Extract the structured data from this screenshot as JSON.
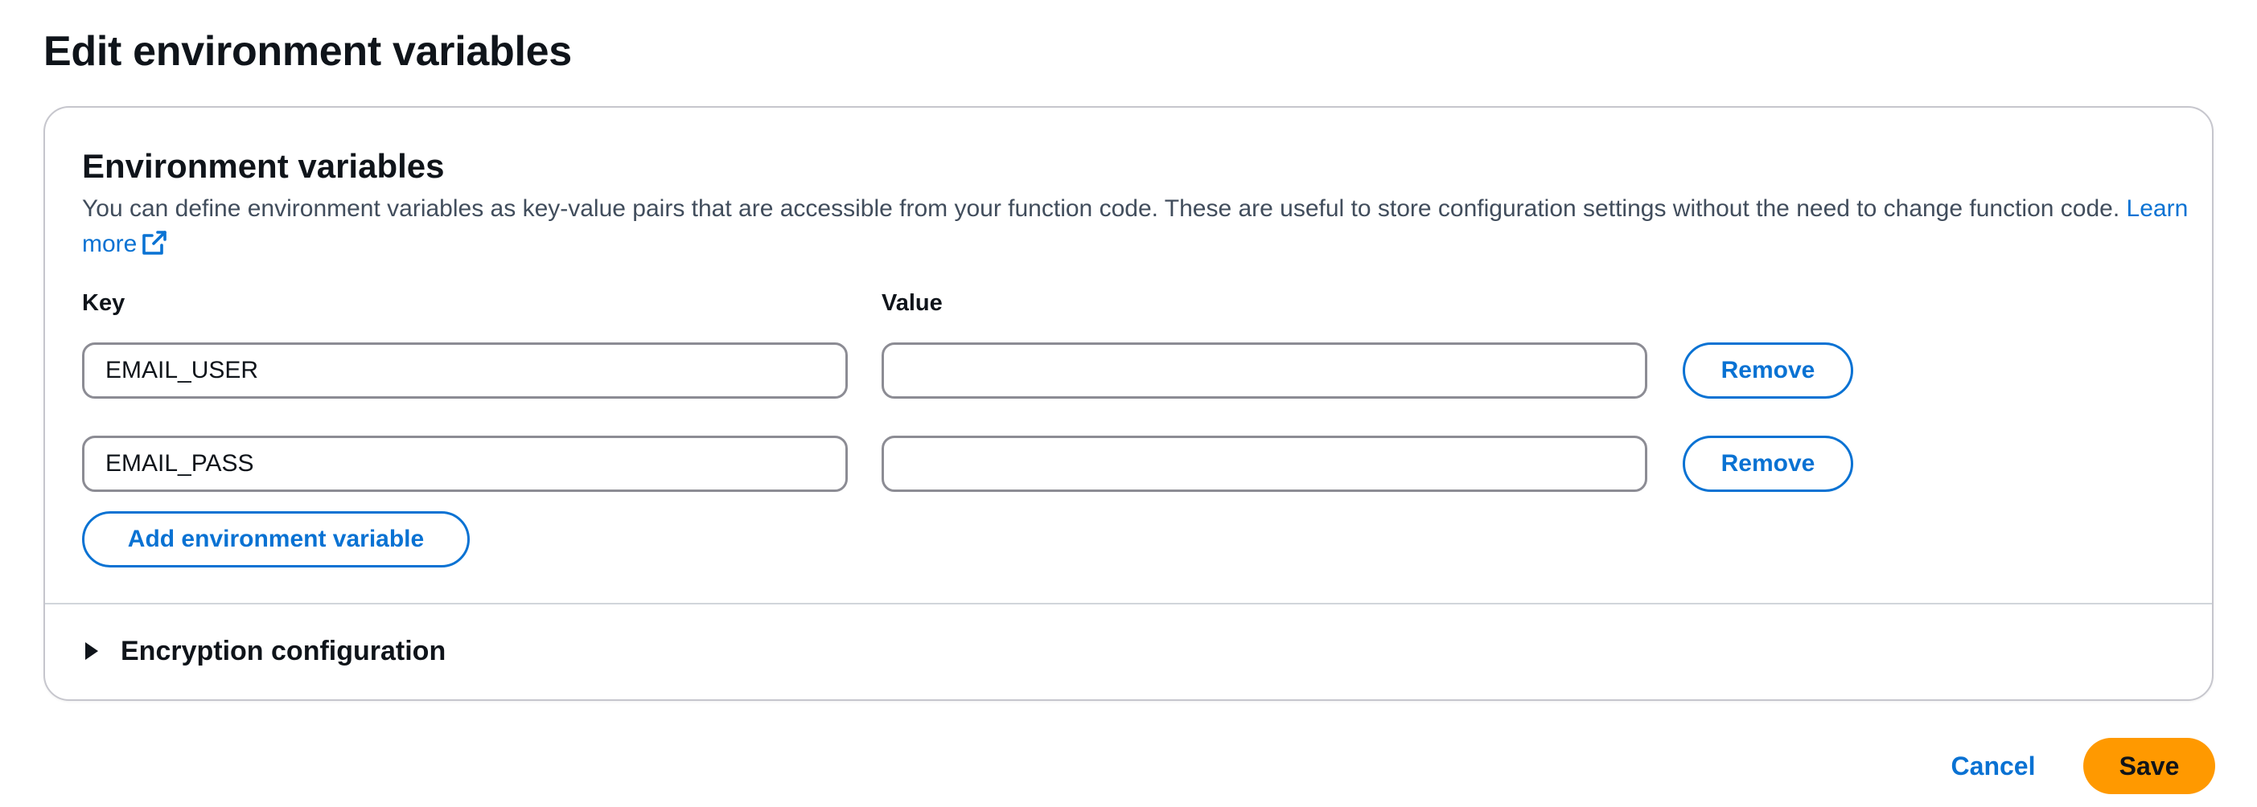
{
  "page": {
    "title": "Edit environment variables"
  },
  "section": {
    "title": "Environment variables",
    "description": "You can define environment variables as key-value pairs that are accessible from your function code. These are useful to store configuration settings without the need to change function code.",
    "learn_more": "Learn more",
    "learn_more_icon": "external-link-icon"
  },
  "columns": {
    "key": "Key",
    "value": "Value"
  },
  "variables": [
    {
      "key": "EMAIL_USER",
      "value": "",
      "remove_label": "Remove"
    },
    {
      "key": "EMAIL_PASS",
      "value": "",
      "remove_label": "Remove"
    }
  ],
  "add_button": "Add environment variable",
  "encryption": {
    "label": "Encryption configuration",
    "expanded": false
  },
  "footer": {
    "cancel": "Cancel",
    "save": "Save"
  },
  "colors": {
    "link": "#0972d3",
    "primary": "#ff9900",
    "text": "#0f141a"
  }
}
